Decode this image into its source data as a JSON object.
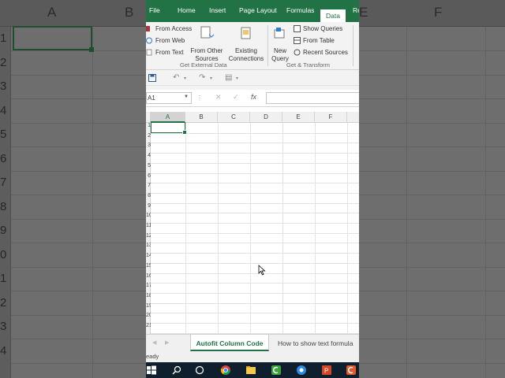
{
  "background": {
    "left_columns": [
      "A"
    ],
    "left_rows": [
      "1",
      "2",
      "3",
      "4",
      "5",
      "6",
      "7",
      "8",
      "9",
      "0",
      "1",
      "2",
      "3",
      "4"
    ],
    "right_columns": [
      "B",
      "E",
      "F"
    ],
    "right_col_b": "B"
  },
  "ribbon": {
    "tabs": [
      {
        "label": "File",
        "active": false
      },
      {
        "label": "Home",
        "active": false
      },
      {
        "label": "Insert",
        "active": false
      },
      {
        "label": "Page Layout",
        "active": false
      },
      {
        "label": "Formulas",
        "active": false
      },
      {
        "label": "Data",
        "active": true
      },
      {
        "label": "Re",
        "active": false
      }
    ],
    "get_external_data": {
      "from_access": "From Access",
      "from_web": "From Web",
      "from_text": "From Text",
      "from_other_sources_l1": "From Other",
      "from_other_sources_l2": "Sources",
      "existing_connections_l1": "Existing",
      "existing_connections_l2": "Connections",
      "group_label": "Get External Data"
    },
    "get_transform": {
      "new_query_l1": "New",
      "new_query_l2": "Query",
      "show_queries": "Show Queries",
      "from_table": "From Table",
      "recent_sources": "Recent Sources",
      "group_label": "Get & Transform"
    }
  },
  "formula_bar": {
    "name_box": "A1",
    "fx": "fx",
    "cancel": "✕",
    "enter": "✓",
    "formula": ""
  },
  "grid": {
    "columns": [
      "A",
      "B",
      "C",
      "D",
      "E",
      "F"
    ],
    "rows": [
      "1",
      "2",
      "3",
      "4",
      "5",
      "6",
      "7",
      "8",
      "9",
      "10",
      "11",
      "12",
      "13",
      "14",
      "15",
      "16",
      "17",
      "18",
      "19",
      "20",
      "21"
    ],
    "active_cell": "A1"
  },
  "sheets": {
    "tabs": [
      "Autofit Column Code",
      "How to show text formula"
    ],
    "active": "Autofit Column Code"
  },
  "status": {
    "text": "eady"
  },
  "colors": {
    "excel_green": "#217346",
    "taskbar": "#0f1f2e"
  }
}
